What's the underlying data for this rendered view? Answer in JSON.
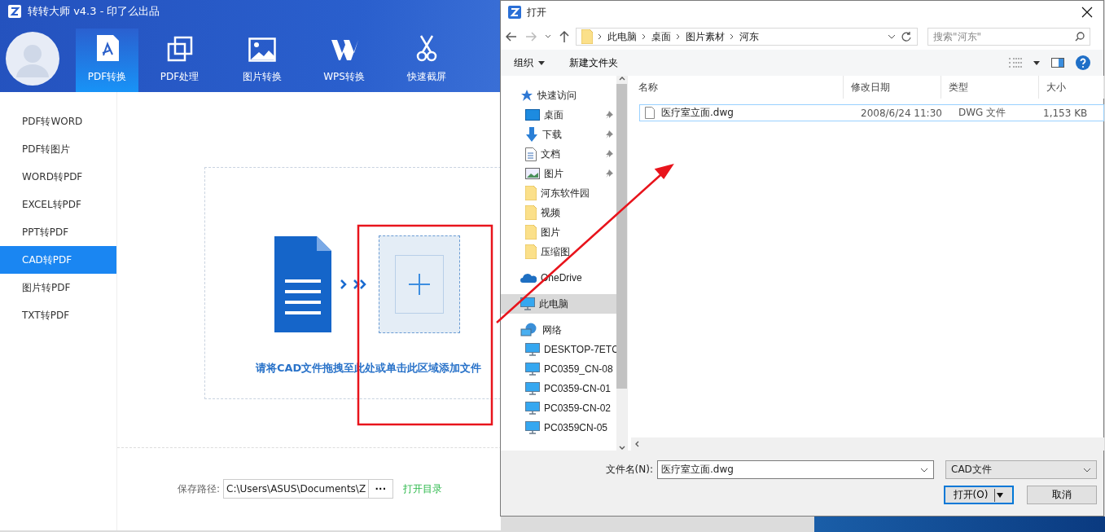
{
  "app": {
    "title": "转转大师 v4.3 - 印了么出品",
    "tabs": [
      {
        "label": "PDF转换",
        "kind": "pdf",
        "selected": true
      },
      {
        "label": "PDF处理",
        "kind": "layers",
        "selected": false
      },
      {
        "label": "图片转换",
        "kind": "image",
        "selected": false
      },
      {
        "label": "WPS转换",
        "kind": "wps",
        "selected": false
      },
      {
        "label": "快速截屏",
        "kind": "scissors",
        "selected": false
      }
    ],
    "sidebar": [
      {
        "label": "PDF转WORD",
        "selected": false
      },
      {
        "label": "PDF转图片",
        "selected": false
      },
      {
        "label": "WORD转PDF",
        "selected": false
      },
      {
        "label": "EXCEL转PDF",
        "selected": false
      },
      {
        "label": "PPT转PDF",
        "selected": false
      },
      {
        "label": "CAD转PDF",
        "selected": true
      },
      {
        "label": "图片转PDF",
        "selected": false
      },
      {
        "label": "TXT转PDF",
        "selected": false
      }
    ],
    "drop_zone": {
      "hint": "请将CAD文件拖拽至此处或单击此区域添加文件"
    },
    "save_path": {
      "label": "保存路径:",
      "value": "C:\\Users\\ASUS\\Documents\\Z",
      "browse": "···",
      "open_folder": "打开目录"
    }
  },
  "dialog": {
    "title": "打开",
    "breadcrumb": [
      "此电脑",
      "桌面",
      "图片素材",
      "河东"
    ],
    "search": {
      "placeholder": "搜索\"河东\""
    },
    "toolbar": [
      {
        "label": "组织",
        "dropdown": true
      },
      {
        "label": "新建文件夹",
        "dropdown": false
      }
    ],
    "nav": [
      {
        "label": "快速访问",
        "kind": "star",
        "selected": false,
        "children": [
          {
            "label": "桌面",
            "kind": "desktop",
            "pinned": true,
            "selected": false
          },
          {
            "label": "下载",
            "kind": "download",
            "pinned": true,
            "selected": false
          },
          {
            "label": "文档",
            "kind": "document",
            "pinned": true,
            "selected": false
          },
          {
            "label": "图片",
            "kind": "pictures",
            "pinned": true,
            "selected": false
          },
          {
            "label": "河东软件园",
            "kind": "folder",
            "pinned": false,
            "selected": false
          },
          {
            "label": "视频",
            "kind": "folder",
            "pinned": false,
            "selected": false
          },
          {
            "label": "图片",
            "kind": "folder",
            "pinned": false,
            "selected": false
          },
          {
            "label": "压缩图",
            "kind": "folder",
            "pinned": false,
            "selected": false
          }
        ]
      },
      {
        "label": "OneDrive",
        "kind": "cloud",
        "selected": false
      },
      {
        "label": "此电脑",
        "kind": "computer",
        "selected": true
      },
      {
        "label": "网络",
        "kind": "network",
        "selected": false,
        "children": [
          {
            "label": "DESKTOP-7ETC",
            "kind": "computer",
            "pinned": false,
            "selected": false
          },
          {
            "label": "PC0359_CN-08",
            "kind": "computer",
            "pinned": false,
            "selected": false
          },
          {
            "label": "PC0359-CN-01",
            "kind": "computer",
            "pinned": false,
            "selected": false
          },
          {
            "label": "PC0359-CN-02",
            "kind": "computer",
            "pinned": false,
            "selected": false
          },
          {
            "label": "PC0359CN-05",
            "kind": "computer",
            "pinned": false,
            "selected": false
          }
        ]
      }
    ],
    "columns": [
      "名称",
      "修改日期",
      "类型",
      "大小"
    ],
    "files": [
      {
        "name": "医疗室立面.dwg",
        "modified": "2008/6/24 11:30",
        "type": "DWG 文件",
        "size": "1,153 KB",
        "focused": true
      }
    ],
    "filename": {
      "label": "文件名(N):",
      "value": "医疗室立面.dwg"
    },
    "filter": "CAD文件",
    "buttons": [
      {
        "label": "打开(O)",
        "kind": "split",
        "default": true
      },
      {
        "label": "取消",
        "kind": "plain",
        "default": false
      }
    ]
  }
}
